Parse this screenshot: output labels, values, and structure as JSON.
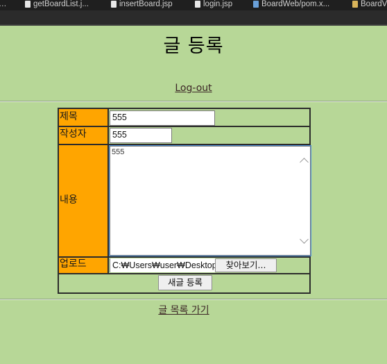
{
  "tabs": [
    {
      "label": "getBoardList.j...",
      "icon": "jsp-file-icon"
    },
    {
      "label": "insertBoard.jsp",
      "icon": "jsp-file-icon"
    },
    {
      "label": "login.jsp",
      "icon": "jsp-file-icon"
    },
    {
      "label": "BoardWeb/pom.x...",
      "icon": "xml-file-icon"
    },
    {
      "label": "BoardV",
      "icon": "java-file-icon"
    }
  ],
  "page": {
    "title": "글 등록",
    "logout_label": "Log-out",
    "list_link_label": "글 목록 가기"
  },
  "form": {
    "title_label": "제목",
    "title_value": "555",
    "writer_label": "작성자",
    "writer_value": "555",
    "content_label": "내용",
    "content_value": "555",
    "upload_label": "업로드",
    "upload_path": "C:₩Users₩user₩Desktop",
    "browse_label": "찾아보기...",
    "submit_label": "새글 등록"
  },
  "colors": {
    "background": "#b7d797",
    "label_background": "#ffa500",
    "border": "#2b2b2b"
  }
}
